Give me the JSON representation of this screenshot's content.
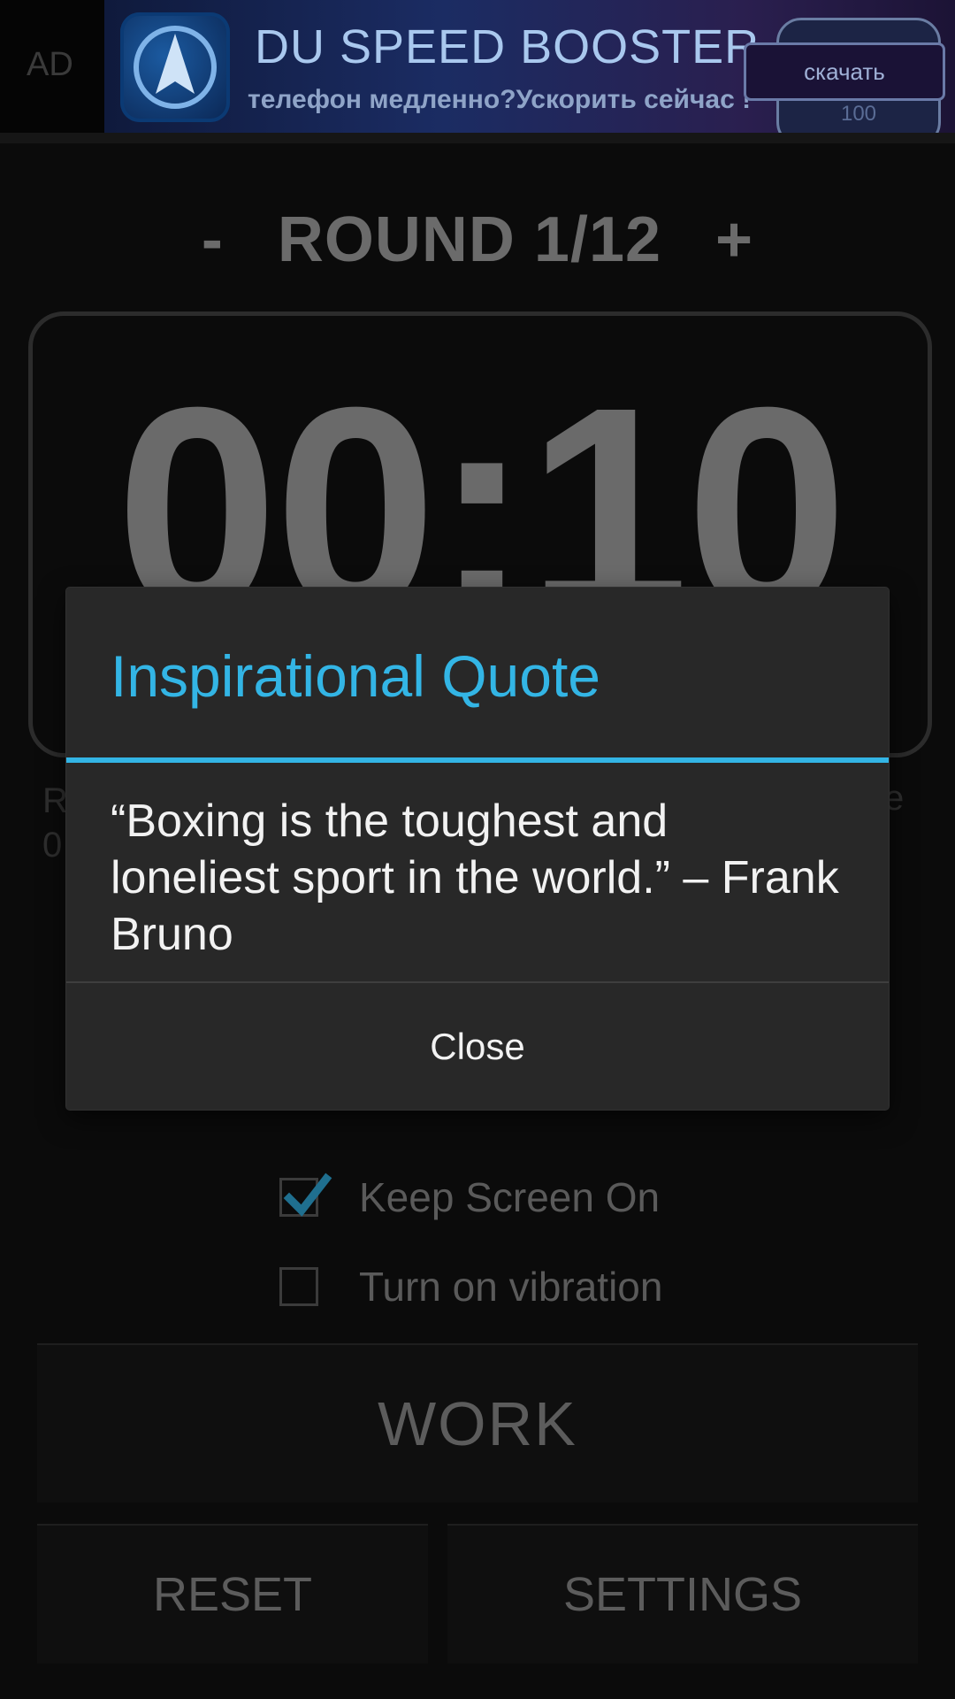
{
  "ad": {
    "label": "AD",
    "title": "DU SPEED BOOSTER",
    "subtitle": "телефон медленно?Ускорить сейчас !",
    "cta": "скачать",
    "gauge_value": "100"
  },
  "round": {
    "minus": "-",
    "label": "ROUND 1/12",
    "plus": "+"
  },
  "timer": {
    "value": "00:10"
  },
  "under": {
    "left_line1": "R",
    "left_line2": "0",
    "right": "e"
  },
  "options": {
    "keep_screen_on": {
      "label": "Keep Screen On",
      "checked": true
    },
    "vibration": {
      "label": "Turn on vibration",
      "checked": false
    }
  },
  "buttons": {
    "work": "WORK",
    "reset": "RESET",
    "settings": "SETTINGS"
  },
  "dialog": {
    "title": "Inspirational Quote",
    "message": "“Boxing is the toughest and loneliest sport in the world.” – Frank Bruno",
    "close_label": "Close"
  },
  "colors": {
    "accent": "#33b5e5",
    "dialog_bg": "#282828",
    "app_bg": "#0b0b0b",
    "timer_text": "#6a6a6a"
  }
}
